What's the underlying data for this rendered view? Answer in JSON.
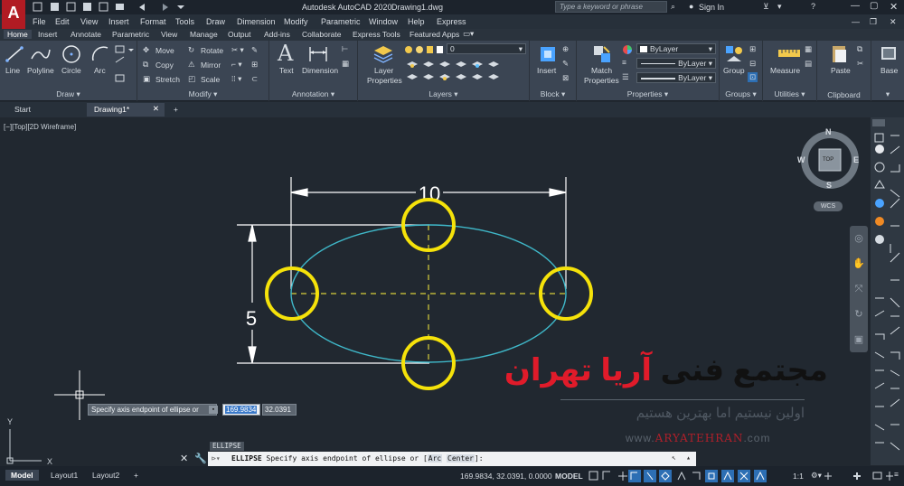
{
  "title_bar": {
    "app_title": "Autodesk AutoCAD 2020",
    "doc_title": "Drawing1.dwg",
    "search_placeholder": "Type a keyword or phrase",
    "sign_in": "Sign In"
  },
  "menu": [
    "File",
    "Edit",
    "View",
    "Insert",
    "Format",
    "Tools",
    "Draw",
    "Dimension",
    "Modify",
    "Parametric",
    "Window",
    "Help",
    "Express"
  ],
  "ribbon_tabs": [
    "Home",
    "Insert",
    "Annotate",
    "Parametric",
    "View",
    "Manage",
    "Output",
    "Add-ins",
    "Collaborate",
    "Express Tools",
    "Featured Apps"
  ],
  "ribbon": {
    "draw": {
      "label": "Draw",
      "line": "Line",
      "polyline": "Polyline",
      "circle": "Circle",
      "arc": "Arc"
    },
    "modify": {
      "label": "Modify",
      "move": "Move",
      "rotate": "Rotate",
      "copy": "Copy",
      "mirror": "Mirror",
      "stretch": "Stretch",
      "scale": "Scale"
    },
    "annotation": {
      "label": "Annotation",
      "text": "Text",
      "dimension": "Dimension"
    },
    "layers": {
      "label": "Layers",
      "layer_properties_1": "Layer",
      "layer_properties_2": "Properties",
      "current_layer": "0"
    },
    "block": {
      "label": "Block",
      "insert": "Insert"
    },
    "properties": {
      "label": "Properties",
      "match_1": "Match",
      "match_2": "Properties",
      "color": "ByLayer",
      "linetype": "ByLayer",
      "lineweight": "ByLayer"
    },
    "groups": {
      "label": "Groups",
      "group": "Group"
    },
    "utilities": {
      "label": "Utilities",
      "measure": "Measure"
    },
    "clipboard": {
      "label": "Clipboard",
      "paste": "Paste"
    },
    "view": {
      "base": "Base"
    }
  },
  "file_tabs": {
    "start": "Start",
    "drawing": "Drawing1*"
  },
  "viewport": {
    "label": "[−][Top][2D Wireframe]",
    "dim_horizontal": "10",
    "dim_vertical": "5",
    "prompt": "Specify axis endpoint of ellipse or",
    "input_x": "169.9834",
    "input_y": "32.0391",
    "axis_x": "X",
    "axis_y": "Y"
  },
  "viewcube": {
    "n": "N",
    "s": "S",
    "e": "E",
    "w": "W",
    "top": "TOP",
    "wcs": "WCS"
  },
  "watermark": {
    "title_black": "مجتمع فنی",
    "title_red": "آریا تهران",
    "subtitle": "اولین نیستیم اما بهترین هستیم",
    "url_prefix": "www.",
    "url_main": "Aryatehran",
    "url_suffix": ".com"
  },
  "command": {
    "history": "ELLIPSE",
    "name": "ELLIPSE",
    "text": "Specify axis endpoint of ellipse or [",
    "opt1": "Arc",
    "opt2": "Center",
    "end": "]:"
  },
  "layout_tabs": [
    "Model",
    "Layout1",
    "Layout2"
  ],
  "status": {
    "coords": "169.9834, 32.0391, 0.0000",
    "model": "MODEL",
    "scale": "1:1"
  },
  "colors": {
    "ellipse": "#3fb8c9",
    "circles": "#f5e20a",
    "centerline": "#d8cf3a",
    "dim": "#ffffff",
    "accent_red": "#e01b2a"
  }
}
